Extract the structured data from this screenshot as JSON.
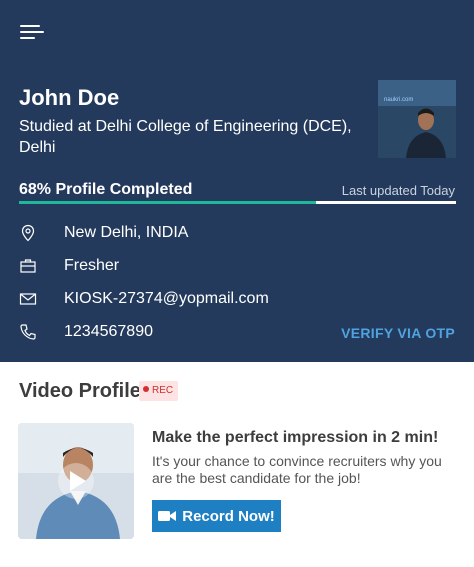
{
  "header": {
    "menu_icon": "hamburger-menu-icon",
    "name": "John Doe",
    "education": "Studied at Delhi College of Engineering (DCE), Delhi",
    "photo_caption": "naukri.com",
    "progress": {
      "label": "68% Profile Completed",
      "percent": 68,
      "last_updated": "Last updated Today"
    },
    "details": [
      {
        "icon": "location-pin-icon",
        "text": "New Delhi, INDIA"
      },
      {
        "icon": "briefcase-icon",
        "text": "Fresher"
      },
      {
        "icon": "mail-icon",
        "text": "KIOSK-27374@yopmail.com"
      },
      {
        "icon": "phone-icon",
        "text": "1234567890"
      }
    ],
    "verify_label": "VERIFY VIA OTP"
  },
  "video_profile": {
    "title": "Video Profile",
    "rec_badge": "REC",
    "headline": "Make the perfect impression in 2 min!",
    "description": "It's your chance to convince recruiters why you are the best candidate for the job!",
    "button_label": "Record Now!",
    "button_icon": "video-camera-icon"
  },
  "colors": {
    "header_bg": "#243a5c",
    "progress_fill": "#1fb89a",
    "accent_link": "#4fa3e0",
    "button_bg": "#1e7fc2",
    "rec_red": "#d32f2f"
  }
}
